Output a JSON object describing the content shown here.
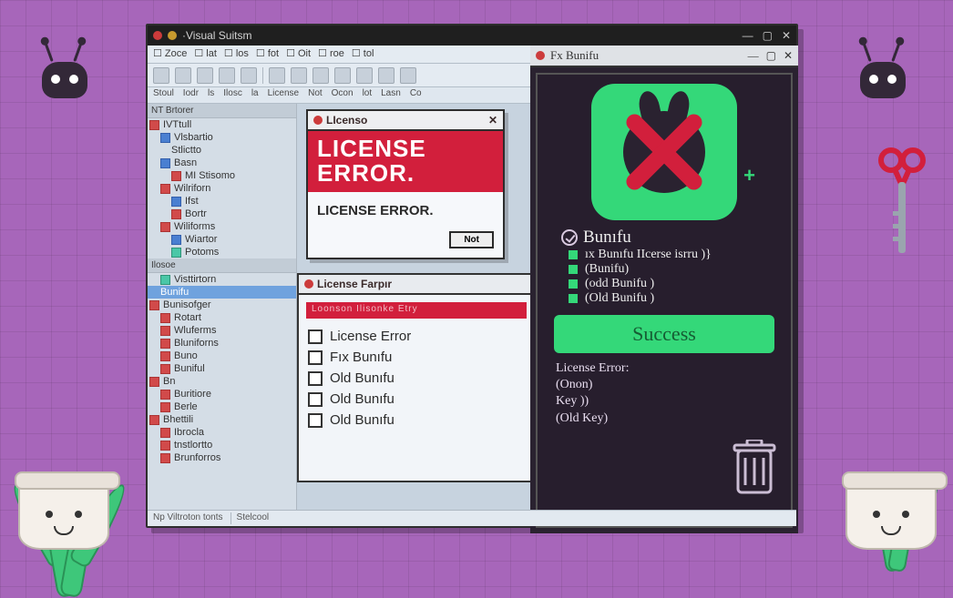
{
  "window": {
    "title": "Visual Suitsm",
    "menus": [
      "Zoce",
      "lat",
      "los",
      "fot",
      "Oit",
      "roe",
      "tol"
    ],
    "subbar": [
      "Stoul",
      "Iodr",
      "ls",
      "Ilosc",
      "la",
      "License",
      "Not",
      "Ocon",
      "lot",
      "Lasn",
      "Co"
    ],
    "status_left": "Np Viltroton tonts",
    "status_right": "Stelcool"
  },
  "tree_top_header": "NT  Brtorer",
  "tree_top": [
    {
      "label": "IVTtull",
      "icon": "red",
      "indent": 0
    },
    {
      "label": "Vlsbartio",
      "icon": "blue",
      "indent": 1
    },
    {
      "label": "Stlictto",
      "icon": "none",
      "indent": 2
    },
    {
      "label": "Basn",
      "icon": "blue",
      "indent": 1
    },
    {
      "label": "MI Stisomo",
      "icon": "red",
      "indent": 2
    },
    {
      "label": "Wilriforn",
      "icon": "red",
      "indent": 1
    },
    {
      "label": "Ifst",
      "icon": "blue",
      "indent": 2
    },
    {
      "label": "Bortr",
      "icon": "red",
      "indent": 2
    },
    {
      "label": "Wiliforms",
      "icon": "red",
      "indent": 1
    },
    {
      "label": "Wiartor",
      "icon": "blue",
      "indent": 2
    },
    {
      "label": "Potoms",
      "icon": "teal",
      "indent": 2
    }
  ],
  "tree_bot_header": "Ilosoe",
  "tree_bot": [
    {
      "label": "Visttirtorn",
      "icon": "teal",
      "indent": 1,
      "selected": false
    },
    {
      "label": "Bunifu",
      "icon": "none",
      "indent": 1,
      "selected": true
    },
    {
      "label": "Bunisofger",
      "icon": "red",
      "indent": 0,
      "selected": false
    },
    {
      "label": "Rotart",
      "icon": "red",
      "indent": 1,
      "selected": false
    },
    {
      "label": "Wluferms",
      "icon": "red",
      "indent": 1,
      "selected": false
    },
    {
      "label": "Bluniforns",
      "icon": "red",
      "indent": 1,
      "selected": false
    },
    {
      "label": "Buno",
      "icon": "red",
      "indent": 1,
      "selected": false
    },
    {
      "label": "Buniful",
      "icon": "red",
      "indent": 1,
      "selected": false
    },
    {
      "label": "Bn",
      "icon": "red",
      "indent": 0,
      "selected": false
    },
    {
      "label": "Buritiore",
      "icon": "red",
      "indent": 1,
      "selected": false
    },
    {
      "label": "Berle",
      "icon": "red",
      "indent": 1,
      "selected": false
    },
    {
      "label": "Bhettili",
      "icon": "red",
      "indent": 0,
      "selected": false
    },
    {
      "label": "Ibrocla",
      "icon": "red",
      "indent": 1,
      "selected": false
    },
    {
      "label": "tnstlortto",
      "icon": "red",
      "indent": 1,
      "selected": false
    },
    {
      "label": "Brunforros",
      "icon": "red",
      "indent": 1,
      "selected": false
    }
  ],
  "dialog": {
    "title": "LIcensᴏ",
    "headline": "LICENSE ERROR.",
    "subtext": "LICENSE ERROR.",
    "ok_label": "Not"
  },
  "license_panel": {
    "title": "License Farpır",
    "redbar_text": "Loonson Ilisonke Etry",
    "items": [
      "License Error",
      "Fıx Bunıfu",
      "Old Bunıfu",
      "Old Bunıfu",
      "Old Bunıfu"
    ]
  },
  "right": {
    "title": "Fx Bunifu",
    "headline": "Bunıfu",
    "lines": [
      "ıx Bunıfu IIcerse isrru )}",
      "(Bunifu)",
      "(odd Bunifu )",
      "(Old Bunifu )"
    ],
    "success_label": "Success",
    "error_title": "License Error:",
    "error_lines": [
      "(Onon)",
      " Key ))",
      "(Old  Key)"
    ]
  }
}
